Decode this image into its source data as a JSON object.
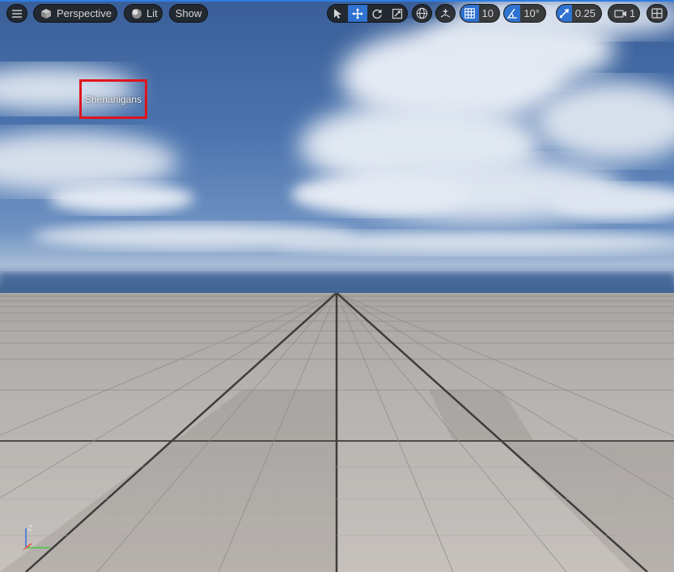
{
  "toolbar": {
    "menu_icon": "hamburger-icon",
    "view_mode": {
      "label": "Perspective",
      "icon": "cube-icon"
    },
    "lighting": {
      "label": "Lit",
      "icon": "lit-sphere-icon"
    },
    "show": {
      "label": "Show"
    },
    "transform_tools": [
      "select-arrow-icon",
      "translate-move-icon",
      "rotate-icon",
      "scale-icon"
    ],
    "active_tool": "translate-move-icon",
    "coordinate_space_icon": "globe-icon",
    "surface_snap_icon": "surface-snap-icon",
    "grid_snap": {
      "icon": "grid-icon",
      "value": "10"
    },
    "rotation_snap": {
      "icon": "angle-icon",
      "value": "10°"
    },
    "scale_snap": {
      "icon": "scale-arrow-icon",
      "value": "0.25"
    },
    "camera_speed": {
      "icon": "camera-icon",
      "value": "1"
    },
    "layout_icon": "viewport-layout-icon"
  },
  "scene": {
    "actor_label": "Shenanigans",
    "highlight_color": "#e0141c",
    "axis_label": "Z"
  },
  "colors": {
    "accent": "#2f72d0",
    "toolbar_bg": "#202020",
    "sky_top": "#3a5f96",
    "floor": "#b8b4b0"
  }
}
